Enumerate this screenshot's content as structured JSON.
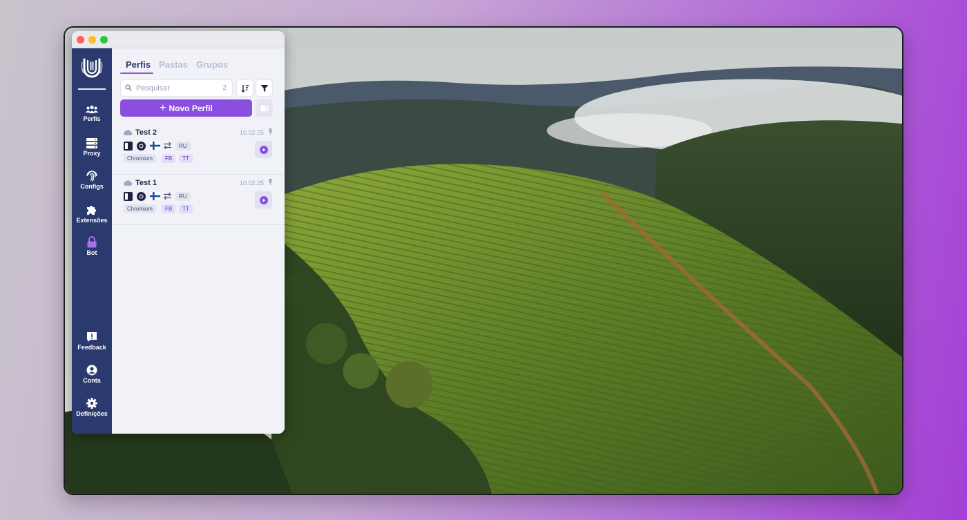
{
  "window": {
    "controls": [
      "close",
      "minimize",
      "maximize"
    ]
  },
  "sidebar": {
    "logo": "fingerprint-u-logo",
    "items": [
      {
        "label": "Perfis",
        "icon": "users-icon"
      },
      {
        "label": "Proxy",
        "icon": "server-icon"
      },
      {
        "label": "Configs",
        "icon": "fingerprint-icon"
      },
      {
        "label": "Extensões",
        "icon": "puzzle-icon"
      },
      {
        "label": "Bot",
        "icon": "lock-icon",
        "accent": "#a86ff0"
      }
    ],
    "bottom_items": [
      {
        "label": "Feedback",
        "icon": "feedback-icon"
      },
      {
        "label": "Conta",
        "icon": "account-icon"
      },
      {
        "label": "Definições",
        "icon": "gear-icon"
      }
    ]
  },
  "tabs": [
    {
      "label": "Perfis",
      "active": true
    },
    {
      "label": "Pastas",
      "active": false
    },
    {
      "label": "Grupos",
      "active": false
    }
  ],
  "search": {
    "placeholder": "Pesquisar",
    "value": "",
    "count": "2"
  },
  "new_profile_label": "Novo Perfil",
  "profiles": [
    {
      "name": "Test 2",
      "date": "10.02.25",
      "country": "RU",
      "tags": [
        "Chromium",
        "FB",
        "TT"
      ],
      "icons": [
        "window-icon",
        "chrome-icon",
        "finland-flag-icon",
        "proxy-swap-icon"
      ]
    },
    {
      "name": "Test 1",
      "date": "10.02.25",
      "country": "RU",
      "tags": [
        "Chromium",
        "FB",
        "TT"
      ],
      "icons": [
        "window-icon",
        "chrome-icon",
        "finland-flag-icon",
        "proxy-swap-icon"
      ]
    }
  ],
  "colors": {
    "sidebar": "#2b3a6e",
    "accent": "#8a4fe0",
    "panel": "#f1f2f8",
    "active_tab": "#2c3566",
    "inactive_tab": "#b8bdd2"
  }
}
